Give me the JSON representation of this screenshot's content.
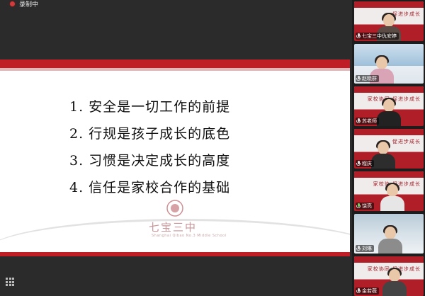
{
  "status": {
    "recording_label": "录制中"
  },
  "slide": {
    "lines": [
      "1. 安全是一切工作的前提",
      "2. 行规是孩子成长的底色",
      "3. 习惯是决定成长的高度",
      "4. 信任是家校合作的基础"
    ],
    "school_name": "七宝三中",
    "school_subtitle": "Shanghai Qibao No.3 Middle School",
    "brand_color": "#c01e26"
  },
  "participants": [
    {
      "name": "七宝三中仇安婷",
      "banner": "促进步成长",
      "active": false,
      "mic_on": false
    },
    {
      "name": "赵晓群",
      "banner": "",
      "active": false,
      "mic_on": false
    },
    {
      "name": "苏老师",
      "banner": "家校协同 促进步成长",
      "active": false,
      "mic_on": false
    },
    {
      "name": "程庆",
      "banner": "促进步成长",
      "active": false,
      "mic_on": false
    },
    {
      "name": "饶亮",
      "banner": "家校协 促进步成长",
      "active": true,
      "mic_on": true
    },
    {
      "name": "刘琳",
      "banner": "",
      "active": false,
      "mic_on": false
    },
    {
      "name": "金若薇",
      "banner": "家校协同 促进步成长",
      "active": false,
      "mic_on": false
    }
  ]
}
